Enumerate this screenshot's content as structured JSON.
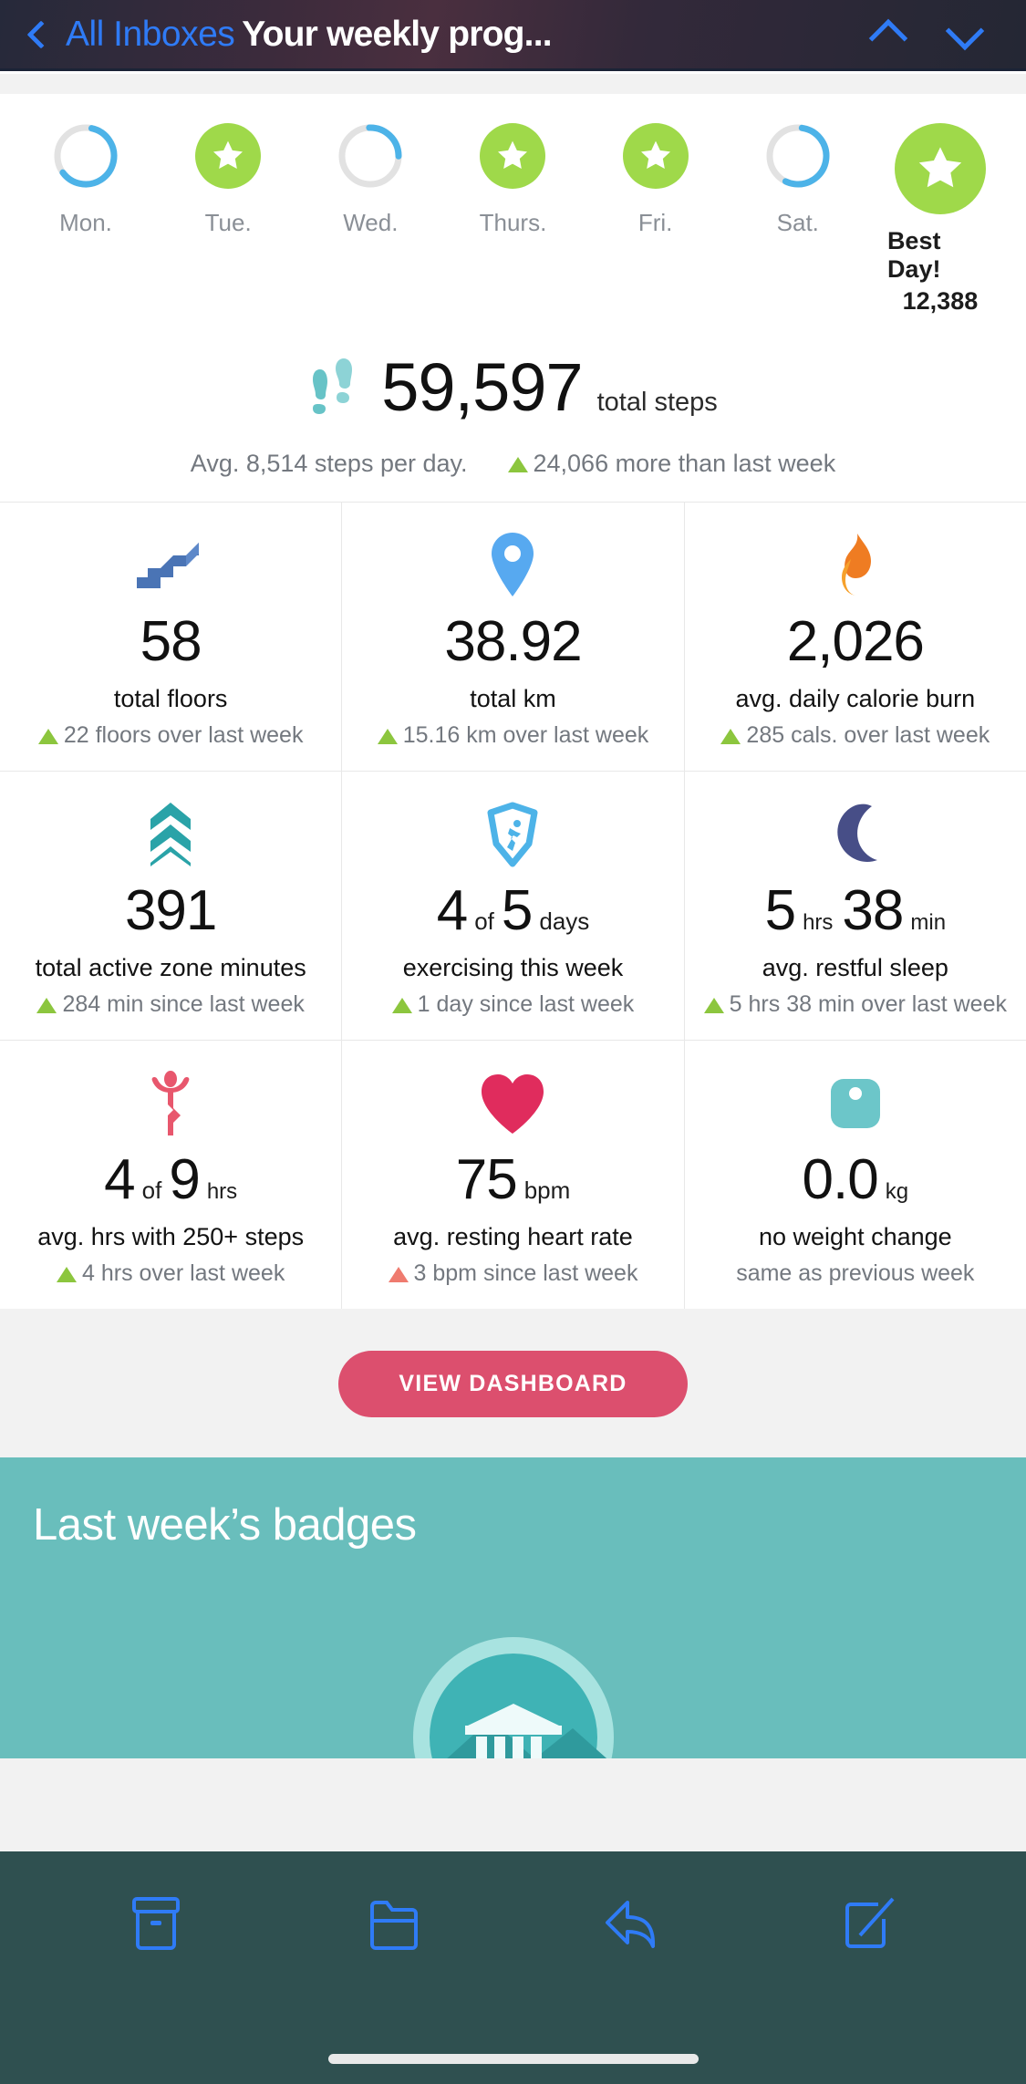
{
  "navbar": {
    "back_label": "All Inboxes",
    "title": "Your weekly prog...",
    "back_icon": "chevron-left-icon",
    "up_icon": "chevron-up-icon",
    "down_icon": "chevron-down-icon"
  },
  "week": {
    "days": [
      {
        "label": "Mon.",
        "type": "ring",
        "progress": 62
      },
      {
        "label": "Tue.",
        "type": "star"
      },
      {
        "label": "Wed.",
        "type": "ring",
        "progress": 26
      },
      {
        "label": "Thurs.",
        "type": "star"
      },
      {
        "label": "Fri.",
        "type": "star"
      },
      {
        "label": "Sat.",
        "type": "ring",
        "progress": 55
      },
      {
        "label": "Best Day!",
        "value": "12,388",
        "type": "star-best"
      }
    ]
  },
  "steps": {
    "icon": "footsteps-icon",
    "value": "59,597",
    "unit": "total steps",
    "avg": "Avg. 8,514 steps per day.",
    "delta": "24,066 more than last week",
    "delta_direction": "up"
  },
  "tiles": [
    {
      "icon": "stairs-icon",
      "value": "58",
      "unit": "",
      "label": "total floors",
      "delta": "22 floors over last week",
      "delta_direction": "up"
    },
    {
      "icon": "location-pin-icon",
      "value": "38.92",
      "unit": "",
      "label": "total km",
      "delta": "15.16 km over last week",
      "delta_direction": "up"
    },
    {
      "icon": "flame-icon",
      "value": "2,026",
      "unit": "",
      "label": "avg. daily calorie burn",
      "delta": "285 cals. over last week",
      "delta_direction": "up"
    },
    {
      "icon": "active-zone-chevrons-icon",
      "value": "391",
      "unit": "",
      "label": "total active zone minutes",
      "delta": "284 min since last week",
      "delta_direction": "up"
    },
    {
      "icon": "exercise-shield-icon",
      "value": "4",
      "of": "of",
      "value2": "5",
      "unit": "days",
      "label": "exercising this week",
      "delta": "1 day since last week",
      "delta_direction": "up"
    },
    {
      "icon": "moon-icon",
      "value": "5",
      "unit": "hrs",
      "value2": "38",
      "unit2": "min",
      "label": "avg. restful sleep",
      "delta": "5 hrs 38 min over last week",
      "delta_direction": "up"
    },
    {
      "icon": "stretch-person-icon",
      "value": "4",
      "of": "of",
      "value2": "9",
      "unit": "hrs",
      "label": "avg. hrs with 250+ steps",
      "delta": "4 hrs over last week",
      "delta_direction": "up"
    },
    {
      "icon": "heart-icon",
      "value": "75",
      "unit": "bpm",
      "label": "avg. resting heart rate",
      "delta": "3 bpm since last week",
      "delta_direction": "down"
    },
    {
      "icon": "scale-icon",
      "value": "0.0",
      "unit": "kg",
      "label": "no weight change",
      "delta": "same as previous week",
      "delta_direction": "none"
    }
  ],
  "cta": {
    "label": "VIEW DASHBOARD"
  },
  "badges": {
    "title": "Last week’s badges",
    "art": "landmark-badge-icon"
  },
  "toolbar": {
    "items": [
      {
        "icon": "archive-icon"
      },
      {
        "icon": "folder-icon"
      },
      {
        "icon": "reply-icon"
      },
      {
        "icon": "compose-icon"
      }
    ]
  },
  "colors": {
    "accent_green": "#9fd94a",
    "accent_blue": "#4db3e8",
    "cta_pink": "#dc4f6e",
    "badge_teal": "#69bebc",
    "toolbar": "#2f5050",
    "link_blue": "#2f7bf6"
  }
}
